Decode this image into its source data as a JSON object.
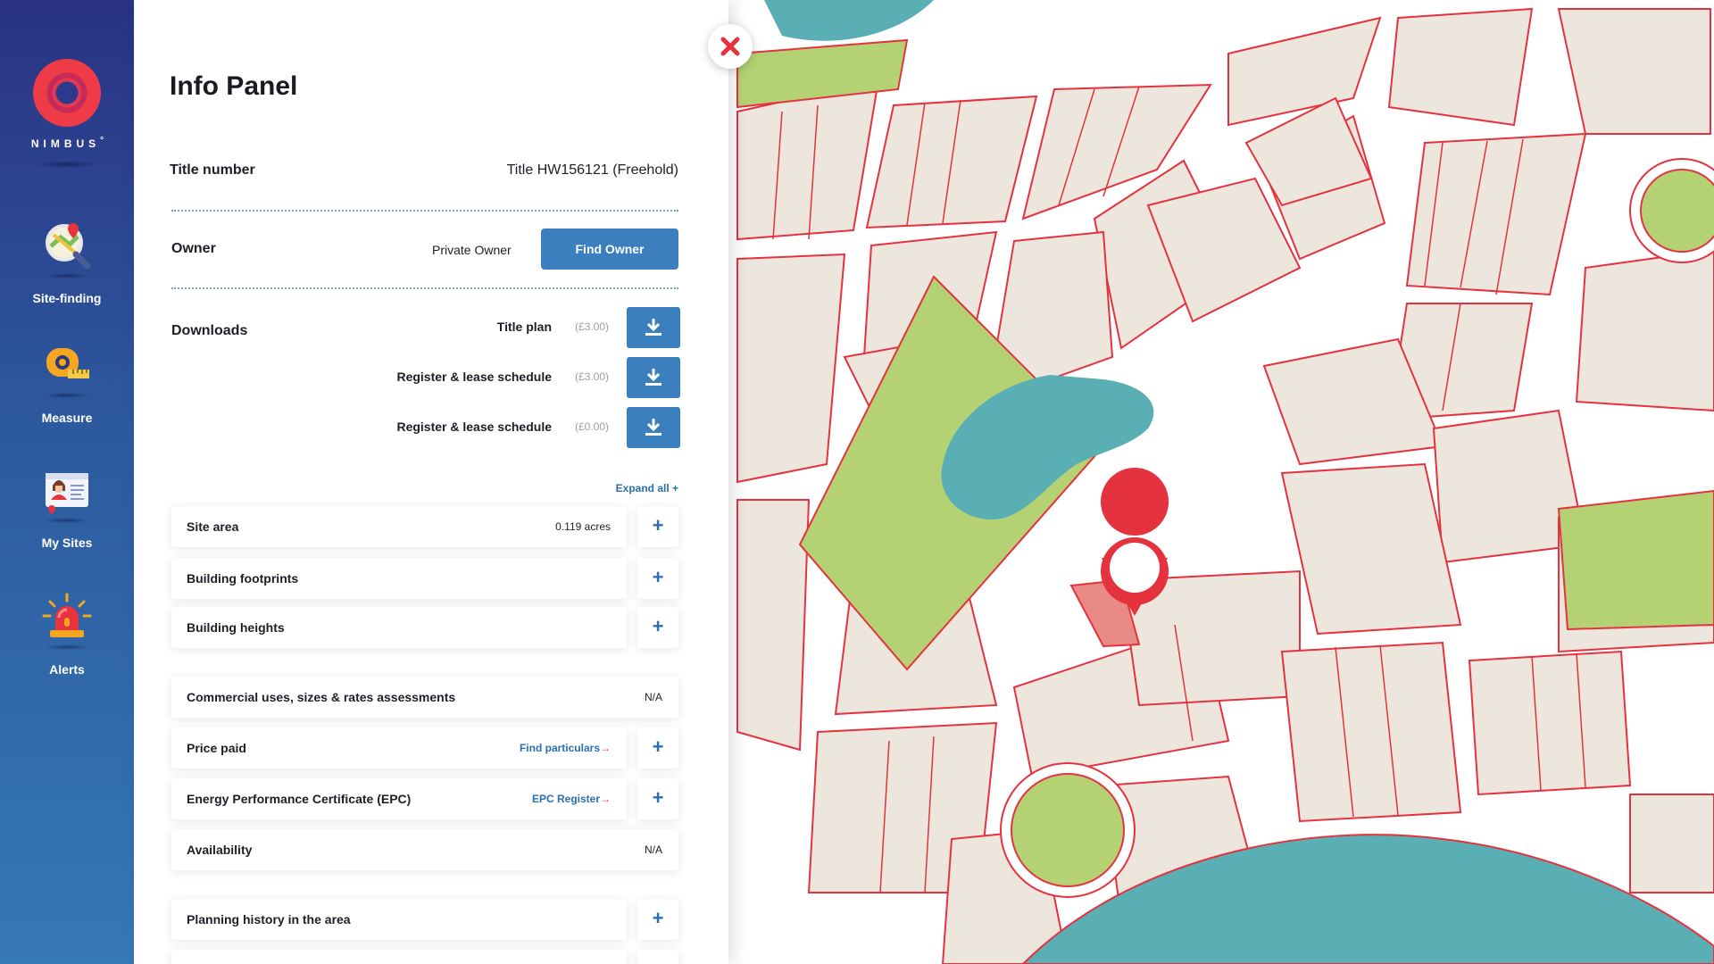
{
  "brand": {
    "name": "NIMBUS",
    "mark": "°"
  },
  "nav": [
    {
      "id": "site-finding",
      "label": "Site-finding",
      "icon": "site-finding-icon"
    },
    {
      "id": "measure",
      "label": "Measure",
      "icon": "tape-measure-icon"
    },
    {
      "id": "my-sites",
      "label": "My Sites",
      "icon": "profile-card-icon"
    },
    {
      "id": "alerts",
      "label": "Alerts",
      "icon": "siren-icon"
    }
  ],
  "panel": {
    "title": "Info Panel",
    "title_number": {
      "label": "Title number",
      "value": "Title HW156121 (Freehold)"
    },
    "owner": {
      "label": "Owner",
      "value": "Private Owner",
      "button": "Find Owner"
    },
    "downloads": {
      "label": "Downloads",
      "items": [
        {
          "name": "Title plan",
          "price": "(£3.00)"
        },
        {
          "name": "Register & lease schedule",
          "price": "(£3.00)"
        },
        {
          "name": "Register & lease schedule",
          "price": "(£0.00)"
        }
      ]
    },
    "expand_all": "Expand all +",
    "sections": [
      {
        "label": "Site area",
        "value": "0.119 acres"
      },
      {
        "label": "Building footprints"
      },
      {
        "label": "Building heights"
      },
      {
        "label": "Commercial uses, sizes & rates assessments",
        "value": "N/A"
      },
      {
        "label": "Price paid",
        "link": "Find particulars",
        "arrow": "→"
      },
      {
        "label": "Energy Performance Certificate (EPC)",
        "link": "EPC Register",
        "arrow": "→"
      },
      {
        "label": "Availability",
        "value": "N/A"
      },
      {
        "label": "Planning history in the area"
      }
    ],
    "plus": "+"
  },
  "colors": {
    "sidebar_top": "#2a3283",
    "sidebar_bottom": "#3579b6",
    "accent_blue": "#3b7fbf",
    "link_blue": "#2b6fb0",
    "brand_red": "#e8323c",
    "map_block": "#ede6dc",
    "map_road_edge": "#e5323f",
    "map_park": "#b4d274",
    "map_water": "#5aafb4"
  }
}
